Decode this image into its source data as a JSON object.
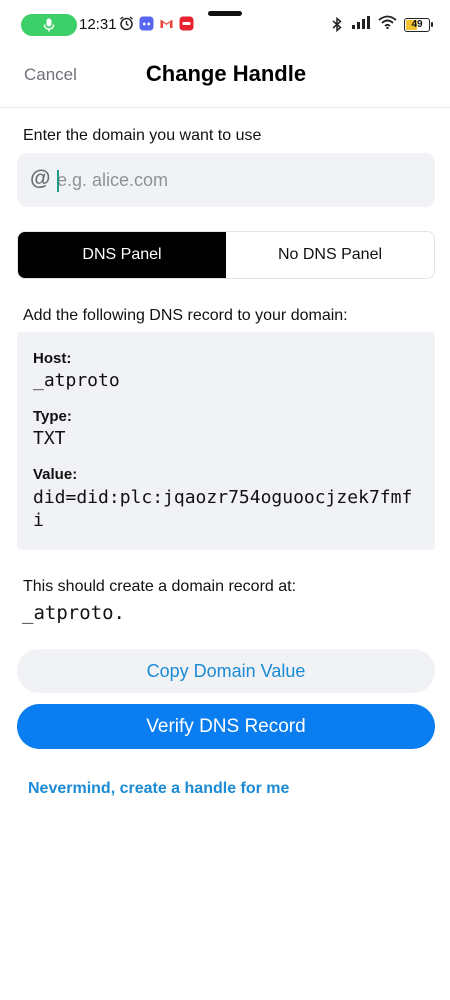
{
  "status_bar": {
    "time": "12:31",
    "battery_level": "49",
    "icons": [
      "microphone-icon",
      "alarm-icon",
      "discord-icon",
      "gmail-icon",
      "app-icon",
      "bluetooth-icon",
      "signal-icon",
      "wifi-icon",
      "battery-icon"
    ]
  },
  "header": {
    "cancel_label": "Cancel",
    "title": "Change Handle"
  },
  "domain": {
    "prompt": "Enter the domain you want to use",
    "at_symbol": "@",
    "placeholder": "e.g. alice.com",
    "value": ""
  },
  "tabs": {
    "dns_panel": "DNS Panel",
    "no_dns_panel": "No DNS Panel",
    "active": "dns_panel"
  },
  "instructions": "Add the following DNS record to your domain:",
  "record": {
    "host_label": "Host:",
    "host_value": "_atproto",
    "type_label": "Type:",
    "type_value": "TXT",
    "value_label": "Value:",
    "value_value": "did=did:plc:jqaozr754oguoocjzek7fmfi"
  },
  "create_record": {
    "label": "This should create a domain record at:",
    "value": "_atproto."
  },
  "buttons": {
    "copy": "Copy Domain Value",
    "verify": "Verify DNS Record",
    "nevermind": "Nevermind, create a handle for me"
  },
  "colors": {
    "accent": "#0a7ef0",
    "link": "#1a8bd4",
    "surface": "#f1f2f5",
    "mic_pill": "#3ccf6a"
  }
}
